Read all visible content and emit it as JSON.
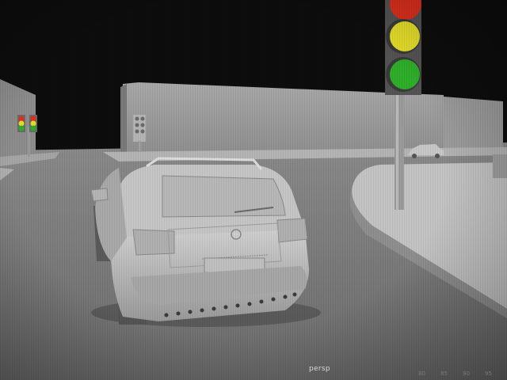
{
  "viewport": {
    "camera_name": "persp",
    "ruler_ticks": [
      "80",
      "85",
      "90",
      "95"
    ]
  },
  "colors": {
    "sky": "#0d0d0d",
    "ground": "#7d7d7d",
    "car_body": "#bdbdbd",
    "traffic_red": "#e0301e",
    "traffic_yellow": "#e6df2a",
    "traffic_green": "#2fae2a"
  }
}
